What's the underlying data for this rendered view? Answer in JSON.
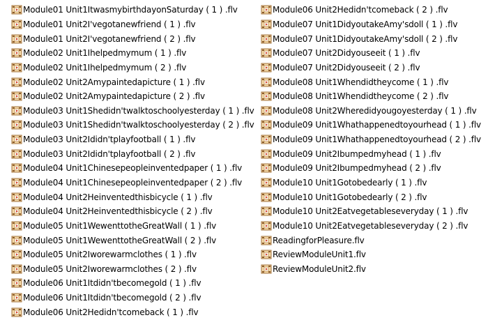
{
  "files": {
    "icon": "flv-video-file-icon",
    "left": [
      "Module01 Unit1ItwasmybirthdayonSaturday ( 1 ) .flv",
      "Module01 Unit2I'vegotanewfriend ( 1 ) .flv",
      "Module01 Unit2I'vegotanewfriend ( 2 ) .flv",
      "Module02 Unit1Ihelpedmymum ( 1 ) .flv",
      "Module02 Unit1Ihelpedmymum ( 2 ) .flv",
      "Module02 Unit2Amypaintedapicture ( 1 ) .flv",
      "Module02 Unit2Amypaintedapicture ( 2 ) .flv",
      "Module03 Unit1Shedidn'twalktoschoolyesterday ( 1 ) .flv",
      "Module03 Unit1Shedidn'twalktoschoolyesterday ( 2 ) .flv",
      "Module03 Unit2Ididn'tplayfootball ( 1 ) .flv",
      "Module03 Unit2Ididn'tplayfootball ( 2 ) .flv",
      "Module04 Unit1Chinesepeopleinventedpaper ( 1 ) .flv",
      "Module04 Unit1Chinesepeopleinventedpaper ( 2 ) .flv",
      "Module04 Unit2Heinventedthisbicycle ( 1 ) .flv",
      "Module04 Unit2Heinventedthisbicycle ( 2 ) .flv",
      "Module05 Unit1WewenttotheGreatWall ( 1 ) .flv",
      "Module05 Unit1WewenttotheGreatWall ( 2 ) .flv",
      "Module05 Unit2Iworewarmclothes ( 1 ) .flv",
      "Module05 Unit2Iworewarmclothes ( 2 ) .flv",
      "Module06 Unit1Itdidn'tbecomegold ( 1 ) .flv",
      "Module06 Unit1Itdidn'tbecomegold ( 2 ) .flv",
      "Module06 Unit2Hedidn'tcomeback ( 1 ) .flv"
    ],
    "right": [
      "Module06 Unit2Hedidn'tcomeback ( 2 ) .flv",
      "Module07 Unit1DidyoutakeAmy'sdoll ( 1 ) .flv",
      "Module07 Unit1DidyoutakeAmy'sdoll ( 2 ) .flv",
      "Module07 Unit2Didyouseeit ( 1 ) .flv",
      "Module07 Unit2Didyouseeit ( 2 ) .flv",
      "Module08 Unit1Whendidtheycome ( 1 ) .flv",
      "Module08 Unit1Whendidtheycome ( 2 ) .flv",
      "Module08 Unit2Wheredidyougoyesterday ( 1 ) .flv",
      "Module09 Unit1Whathappenedtoyourhead ( 1 ) .flv",
      "Module09 Unit1Whathappenedtoyourhead ( 2 ) .flv",
      "Module09 Unit2Ibumpedmyhead ( 1 ) .flv",
      "Module09 Unit2Ibumpedmyhead ( 2 ) .flv",
      "Module10 Unit1Gotobedearly ( 1 ) .flv",
      "Module10 Unit1Gotobedearly ( 2 ) .flv",
      "Module10 Unit2Eatvegetableseveryday ( 1 ) .flv",
      "Module10 Unit2Eatvegetableseveryday ( 2 ) .flv",
      "ReadingforPleasure.flv",
      "ReviewModuleUnit1.flv",
      "ReviewModuleUnit2.flv"
    ]
  }
}
